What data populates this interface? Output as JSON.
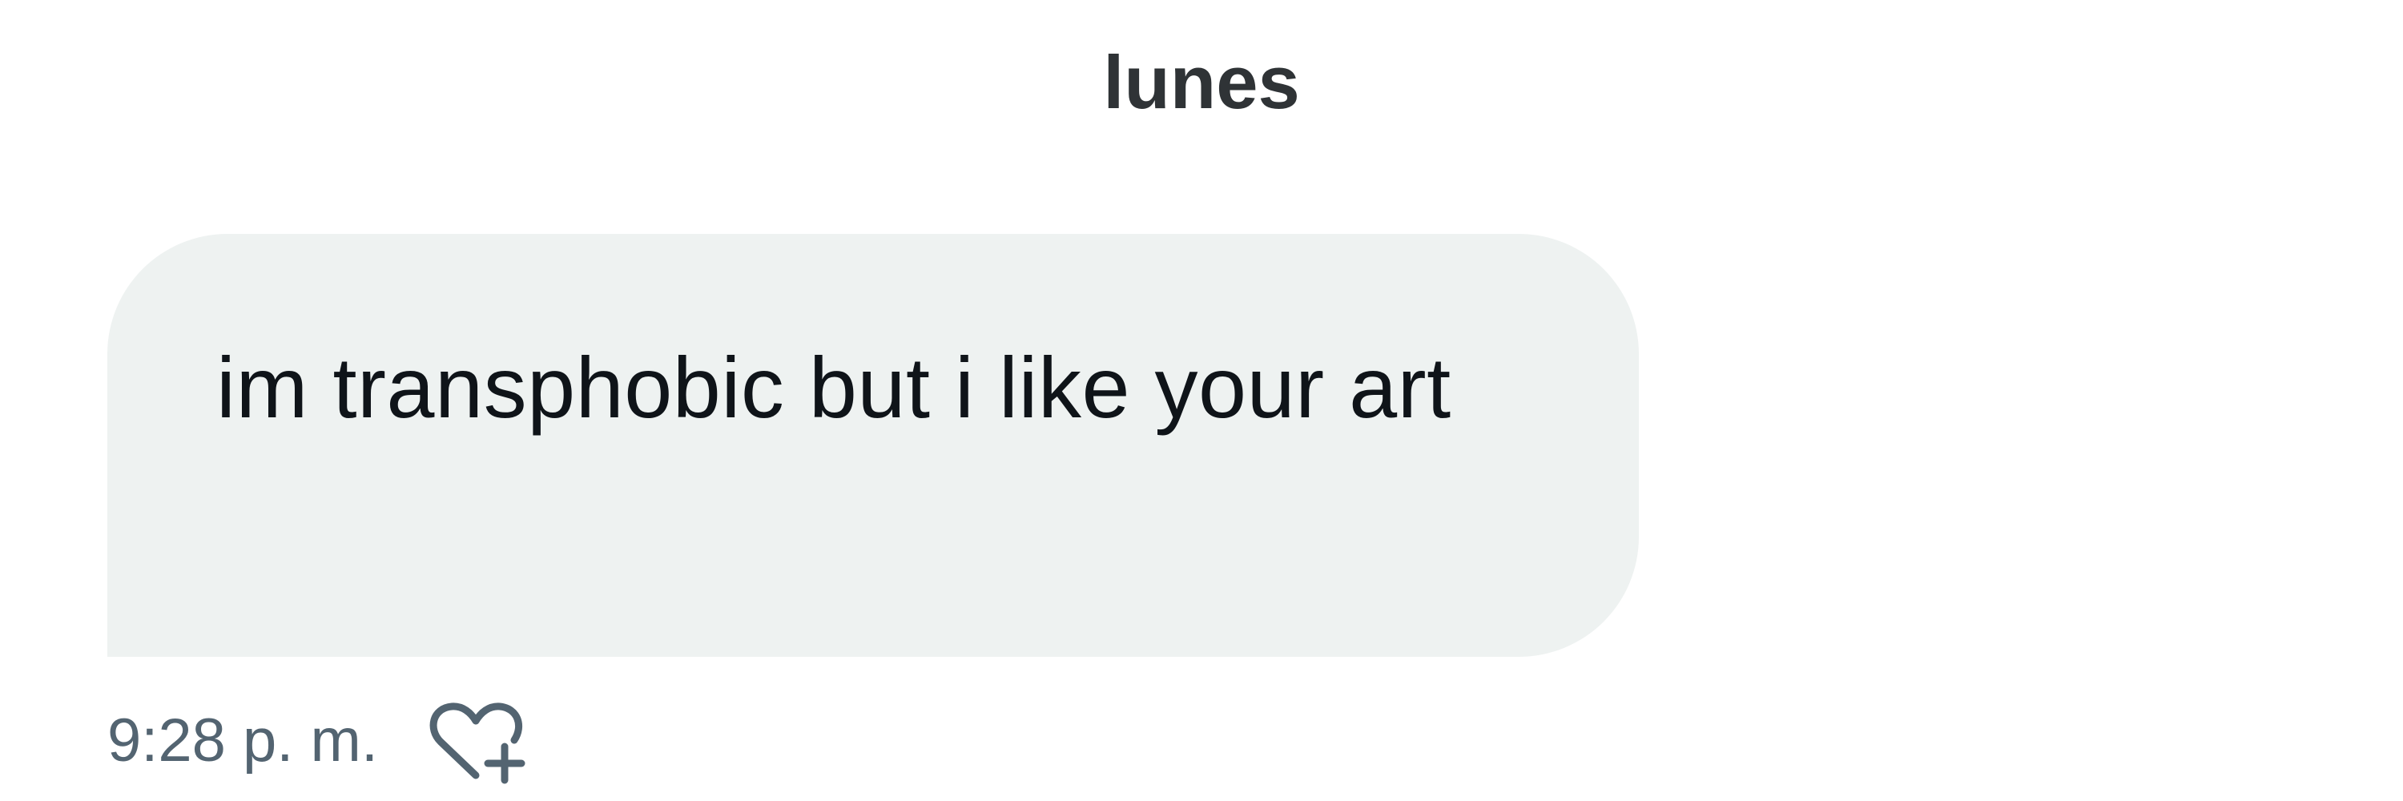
{
  "thread": {
    "day_label": "lunes"
  },
  "message": {
    "text": "im transphobic but i like your art",
    "timestamp": "9:28 p. m.",
    "react_icon": "heart-plus-icon",
    "bubble_color": "#eef2f1",
    "text_color": "#0f1419",
    "meta_color": "#536471"
  }
}
